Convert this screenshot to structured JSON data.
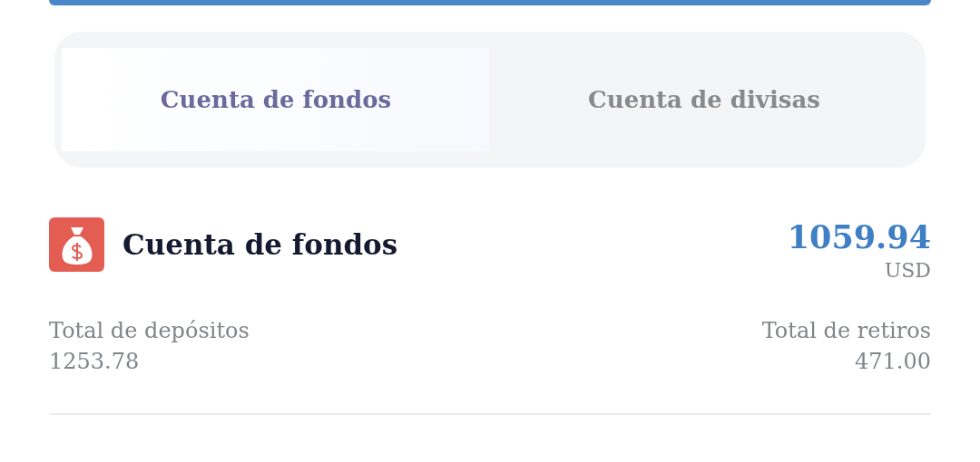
{
  "tabs": [
    {
      "label": "Cuenta de fondos",
      "selected": true
    },
    {
      "label": "Cuenta de divisas",
      "selected": false
    }
  ],
  "account": {
    "title": "Cuenta de fondos",
    "balance": "1059.94",
    "currency": "USD"
  },
  "totals": [
    {
      "label": "Total de depósitos",
      "value": "1253.78"
    },
    {
      "label": "Total de retiros",
      "value": "471.00"
    }
  ]
}
